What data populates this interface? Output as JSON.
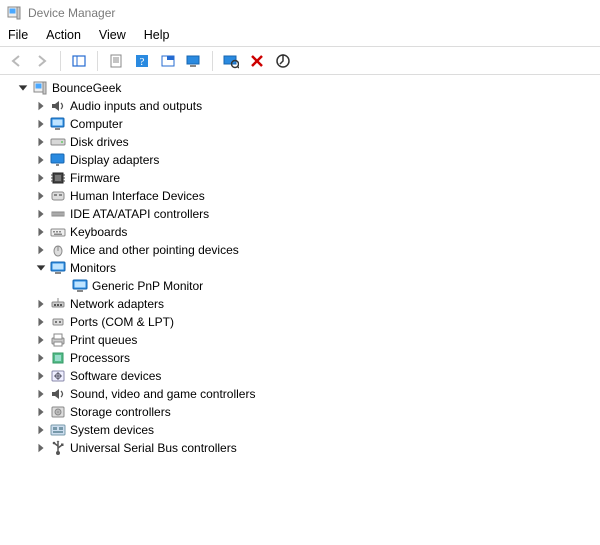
{
  "window": {
    "title": "Device Manager"
  },
  "menu": {
    "file": "File",
    "action": "Action",
    "view": "View",
    "help": "Help"
  },
  "tree": {
    "root": {
      "label": "BounceGeek",
      "expanded": true
    },
    "categories": [
      {
        "id": "audio",
        "label": "Audio inputs and outputs",
        "icon": "speaker",
        "expanded": false
      },
      {
        "id": "computer",
        "label": "Computer",
        "icon": "computer",
        "expanded": false
      },
      {
        "id": "disk",
        "label": "Disk drives",
        "icon": "disk",
        "expanded": false
      },
      {
        "id": "display",
        "label": "Display adapters",
        "icon": "display",
        "expanded": false
      },
      {
        "id": "firmware",
        "label": "Firmware",
        "icon": "chip",
        "expanded": false
      },
      {
        "id": "hid",
        "label": "Human Interface Devices",
        "icon": "hid",
        "expanded": false
      },
      {
        "id": "ide",
        "label": "IDE ATA/ATAPI controllers",
        "icon": "ide",
        "expanded": false
      },
      {
        "id": "keyboard",
        "label": "Keyboards",
        "icon": "keyboard",
        "expanded": false
      },
      {
        "id": "mouse",
        "label": "Mice and other pointing devices",
        "icon": "mouse",
        "expanded": false
      },
      {
        "id": "monitor",
        "label": "Monitors",
        "icon": "monitor",
        "expanded": true,
        "children": [
          {
            "id": "pnp-monitor",
            "label": "Generic PnP Monitor",
            "icon": "monitor"
          }
        ]
      },
      {
        "id": "network",
        "label": "Network adapters",
        "icon": "network",
        "expanded": false
      },
      {
        "id": "ports",
        "label": "Ports (COM & LPT)",
        "icon": "port",
        "expanded": false
      },
      {
        "id": "printq",
        "label": "Print queues",
        "icon": "printer",
        "expanded": false
      },
      {
        "id": "cpu",
        "label": "Processors",
        "icon": "cpu",
        "expanded": false
      },
      {
        "id": "software",
        "label": "Software devices",
        "icon": "software",
        "expanded": false
      },
      {
        "id": "sound",
        "label": "Sound, video and game controllers",
        "icon": "speaker",
        "expanded": false
      },
      {
        "id": "storage",
        "label": "Storage controllers",
        "icon": "storage",
        "expanded": false
      },
      {
        "id": "system",
        "label": "System devices",
        "icon": "system",
        "expanded": false
      },
      {
        "id": "usb",
        "label": "Universal Serial Bus controllers",
        "icon": "usb",
        "expanded": false
      }
    ]
  }
}
